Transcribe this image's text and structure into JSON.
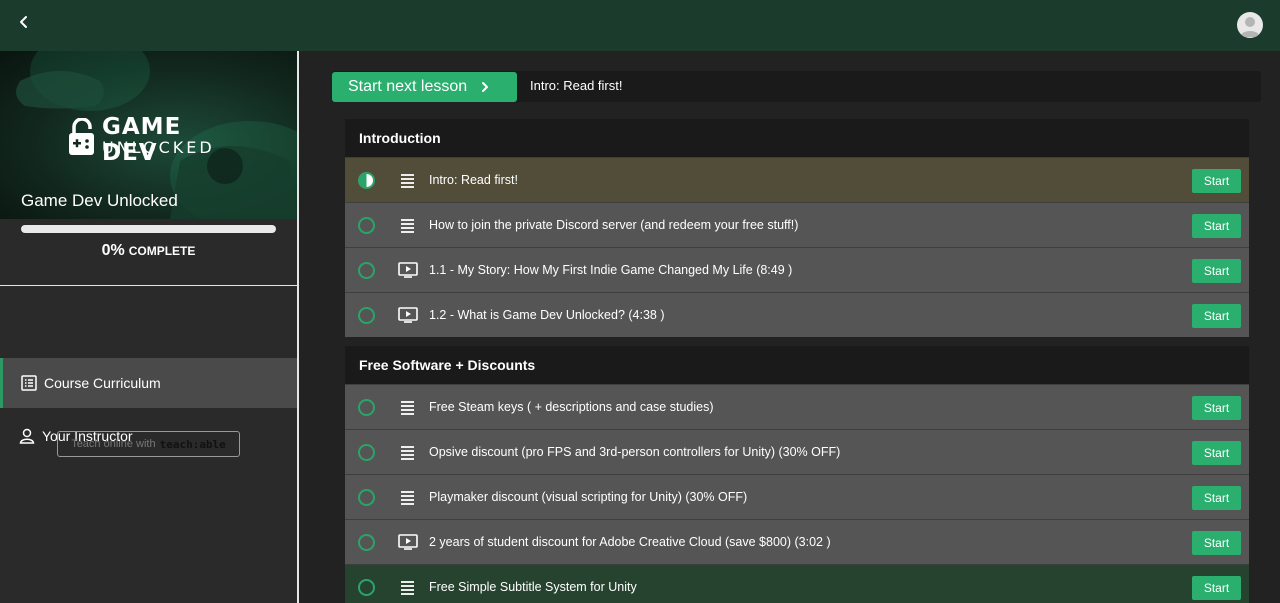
{
  "course": {
    "title": "Game Dev Unlocked",
    "logo_line1": "GAME DEV",
    "logo_line2": "UNLOCKED",
    "progress_percent_text": "0%",
    "progress_fraction": 0.0,
    "progress_label": "COMPLETE"
  },
  "nav": {
    "curriculum_label": "Course Curriculum",
    "instructor_label": "Your Instructor"
  },
  "teachable": {
    "text": "Teach online with",
    "brand": "teach:able"
  },
  "next_lesson": {
    "button_label": "Start next lesson",
    "lesson_name": "Intro: Read first!"
  },
  "colors": {
    "accent": "#2aaf6e",
    "topbar": "#1b3b2c",
    "current_row": "#524d39",
    "highlight_row": "#26432f"
  },
  "sections": [
    {
      "title": "Introduction",
      "lessons": [
        {
          "title": "Intro: Read first!",
          "icon": "text-lines-icon",
          "start": "Start",
          "status": "in-progress"
        },
        {
          "title": "How to join the private Discord server (and redeem your free stuff!)",
          "icon": "text-lines-icon",
          "start": "Start",
          "status": "not-started"
        },
        {
          "title": "1.1 - My Story: How My First Indie Game Changed My Life (8:49 )",
          "icon": "video-play-icon",
          "start": "Start",
          "status": "not-started"
        },
        {
          "title": "1.2 - What is Game Dev Unlocked? (4:38 )",
          "icon": "video-play-icon",
          "start": "Start",
          "status": "not-started"
        }
      ]
    },
    {
      "title": "Free Software + Discounts",
      "lessons": [
        {
          "title": "Free Steam keys ( + descriptions and case studies)",
          "icon": "text-lines-icon",
          "start": "Start",
          "status": "not-started"
        },
        {
          "title": "Opsive discount (pro FPS and 3rd-person controllers for Unity) (30% OFF)",
          "icon": "text-lines-icon",
          "start": "Start",
          "status": "not-started"
        },
        {
          "title": "Playmaker discount (visual scripting for Unity) (30% OFF)",
          "icon": "text-lines-icon",
          "start": "Start",
          "status": "not-started"
        },
        {
          "title": "2 years of student discount for Adobe Creative Cloud (save $800) (3:02 )",
          "icon": "video-play-icon",
          "start": "Start",
          "status": "not-started"
        },
        {
          "title": "Free Simple Subtitle System for Unity",
          "icon": "text-lines-icon",
          "start": "Start",
          "status": "not-started"
        }
      ]
    }
  ]
}
